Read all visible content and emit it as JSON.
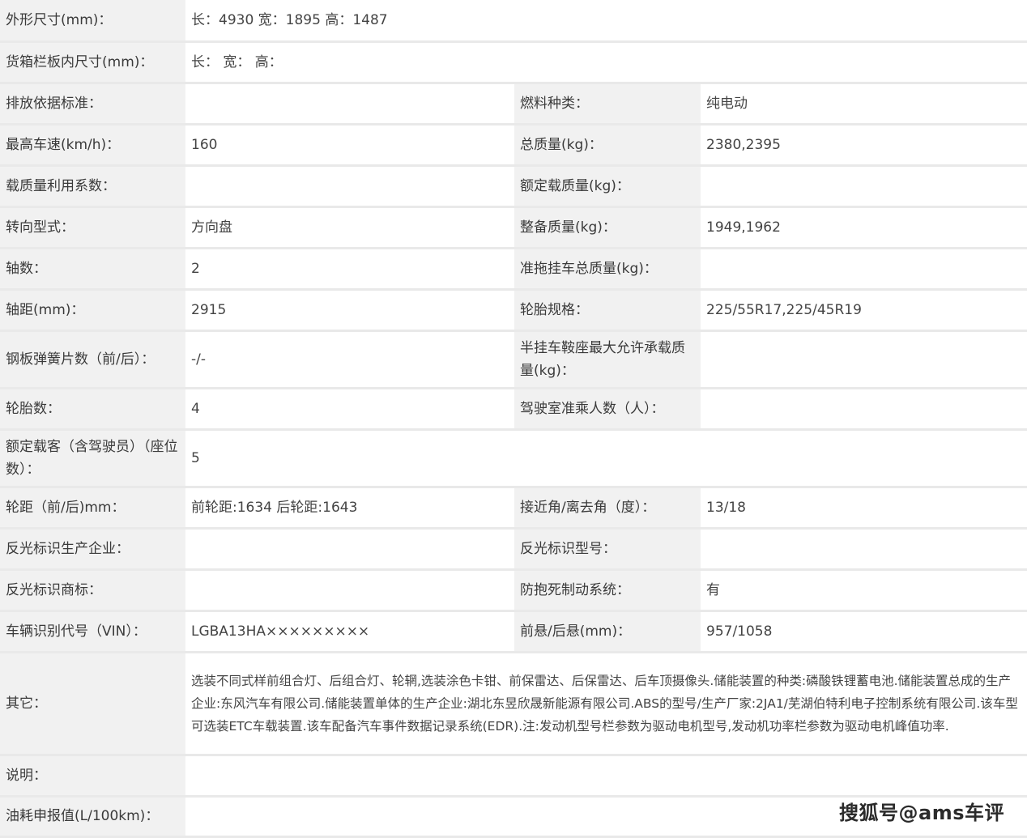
{
  "rows": [
    {
      "l1": "外形尺寸(mm)：",
      "v1": "长：4930 宽：1895 高：1487"
    },
    {
      "l1": "货箱栏板内尺寸(mm)：",
      "v1": "长： 宽： 高："
    },
    {
      "l1": "排放依据标准：",
      "v1": "",
      "l2": "燃料种类：",
      "v2": "纯电动"
    },
    {
      "l1": "最高车速(km/h)：",
      "v1": "160",
      "l2": "总质量(kg)：",
      "v2": "2380,2395"
    },
    {
      "l1": "载质量利用系数：",
      "v1": "",
      "l2": "额定载质量(kg)：",
      "v2": ""
    },
    {
      "l1": "转向型式：",
      "v1": "方向盘",
      "l2": "整备质量(kg)：",
      "v2": "1949,1962"
    },
    {
      "l1": "轴数：",
      "v1": "2",
      "l2": "准拖挂车总质量(kg)：",
      "v2": ""
    },
    {
      "l1": "轴距(mm)：",
      "v1": "2915",
      "l2": "轮胎规格：",
      "v2": "225/55R17,225/45R19"
    },
    {
      "l1": "钢板弹簧片数（前/后）：",
      "v1": "-/-",
      "l2": "半挂车鞍座最大允许承载质量(kg)：",
      "v2": ""
    },
    {
      "l1": "轮胎数：",
      "v1": "4",
      "l2": "驾驶室准乘人数（人）：",
      "v2": ""
    },
    {
      "l1": "额定载客（含驾驶员）（座位数）：",
      "v1": "5"
    },
    {
      "l1": "轮距（前/后)mm：",
      "v1": "前轮距:1634 后轮距:1643",
      "l2": "接近角/离去角（度）：",
      "v2": "13/18"
    },
    {
      "l1": "反光标识生产企业：",
      "v1": "",
      "l2": "反光标识型号：",
      "v2": ""
    },
    {
      "l1": "反光标识商标：",
      "v1": "",
      "l2": "防抱死制动系统：",
      "v2": "有"
    },
    {
      "l1": "车辆识别代号（VIN）：",
      "v1": "LGBA13HA×××××××××",
      "l2": "前悬/后悬(mm)：",
      "v2": "957/1058"
    },
    {
      "l1": "其它：",
      "v1": "选装不同式样前组合灯、后组合灯、轮辋,选装涂色卡钳、前保雷达、后保雷达、后车顶摄像头.储能装置的种类:磷酸铁锂蓄电池.储能装置总成的生产企业:东风汽车有限公司.储能装置单体的生产企业:湖北东昱欣晟新能源有限公司.ABS的型号/生产厂家:2JA1/芜湖伯特利电子控制系统有限公司.该车型可选装ETC车载装置.该车配备汽车事件数据记录系统(EDR).注:发动机型号栏参数为驱动电机型号,发动机功率栏参数为驱动电机峰值功率."
    },
    {
      "l1": "说明：",
      "v1": ""
    },
    {
      "l1": "油耗申报值(L/100km)：",
      "v1": ""
    }
  ],
  "watermark": "搜狐号@ams车评"
}
